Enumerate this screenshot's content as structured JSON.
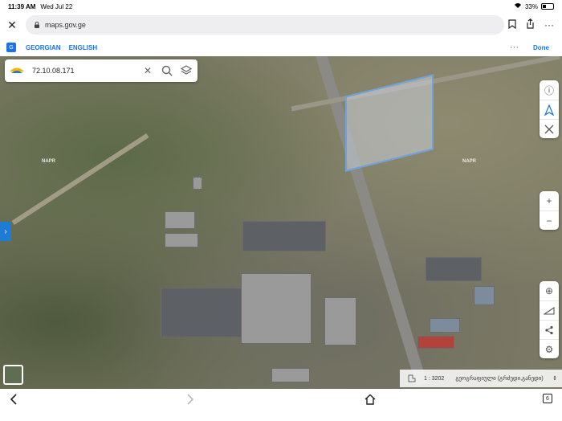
{
  "status": {
    "time": "11:39 AM",
    "date": "Wed Jul 22",
    "battery": "33%",
    "battery_level": 0.33
  },
  "browser": {
    "url": "maps.gov.ge"
  },
  "translate": {
    "lang1": "GEORGIAN",
    "lang2": "ENGLISH",
    "more": "···",
    "done": "Done"
  },
  "search": {
    "value": "72.10.08.171"
  },
  "map": {
    "label_left": "NAPR",
    "label_right": "NAPR"
  },
  "scale": {
    "value": "1 : 3202",
    "locale": "გეოგრაფიული (გრძედი,განედი)"
  },
  "icons": {
    "close": "close-icon",
    "lock": "lock-icon",
    "bookmark": "bookmark-icon",
    "share": "share-icon",
    "more": "more-icon"
  },
  "colors": {
    "accent": "#1a73e8",
    "parcel_border": "#6da3dc",
    "side_toggle": "#1e7bd6"
  },
  "bottom": {
    "tab_count": "6"
  }
}
